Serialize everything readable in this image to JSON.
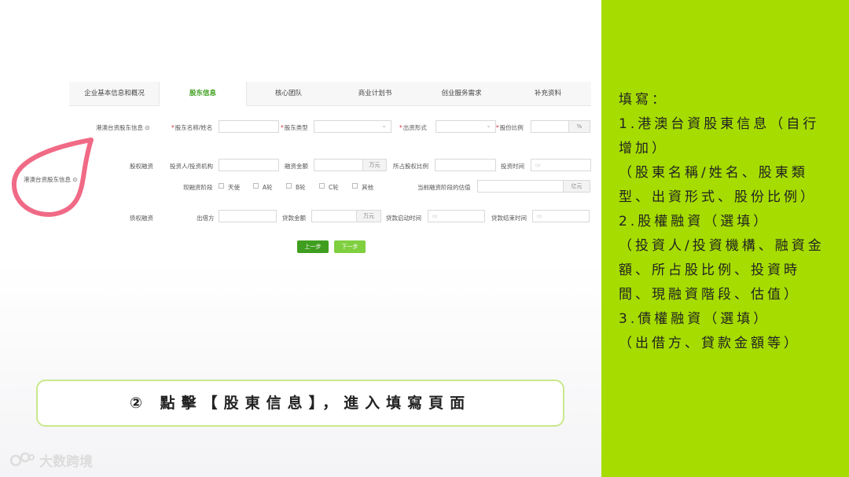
{
  "tabs": [
    {
      "label": "企业基本信息和概况",
      "active": false
    },
    {
      "label": "股东信息",
      "active": true
    },
    {
      "label": "核心团队",
      "active": false
    },
    {
      "label": "商业计划书",
      "active": false
    },
    {
      "label": "创业服务需求",
      "active": false
    },
    {
      "label": "补充资料",
      "active": false
    }
  ],
  "form": {
    "section_hk": "港澳台资股东信息 ⊙",
    "section_hk_outer": "港澳台资股东信息 ⊙",
    "shareholder_name_label": "股东名称/姓名",
    "shareholder_type_label": "股东类型",
    "contribution_label": "出资形式",
    "share_ratio_label": "股份比例",
    "share_ratio_unit": "%",
    "equity_section": "股权融资",
    "investor_label": "投资人/投资机构",
    "amount_label": "融资金额",
    "amount_unit": "万元",
    "equity_ratio_label": "所占股权比例",
    "invest_time_label": "投资时间",
    "stage_label": "现融资阶段",
    "stages": [
      "天使",
      "A轮",
      "B轮",
      "C轮",
      "其他"
    ],
    "valuation_label": "当前融资阶段的估值",
    "valuation_unit": "亿元",
    "debt_section": "债权融资",
    "lender_label": "出借方",
    "loan_amount_label": "贷款金额",
    "loan_unit": "万元",
    "loan_start_label": "贷款启动时间",
    "loan_end_label": "贷款结束时间",
    "prev_button": "上一步",
    "next_button": "下一步"
  },
  "instructions": {
    "title": "填寫：",
    "lines": [
      "1.港澳台資股東信息（自行增加）",
      "（股東名稱/姓名、股東類型、出資形式、股份比例）",
      "2.股權融資（選填）",
      "（投資人/投資機構、融資金額、所占股比例、投資時間、現融資階段、估值）",
      "3.債權融資（選填）",
      "（出借方、貸款金額等）"
    ]
  },
  "caption": "② 點擊【股東信息】，進入填寫頁面",
  "logo_text": "大数跨境",
  "colors": {
    "accent_green": "#a6dc00",
    "tab_active": "#3d9e1c",
    "highlight_loop": "#f06a86",
    "prev_button": "#3f9e1f",
    "next_button": "#7fcf3f"
  }
}
